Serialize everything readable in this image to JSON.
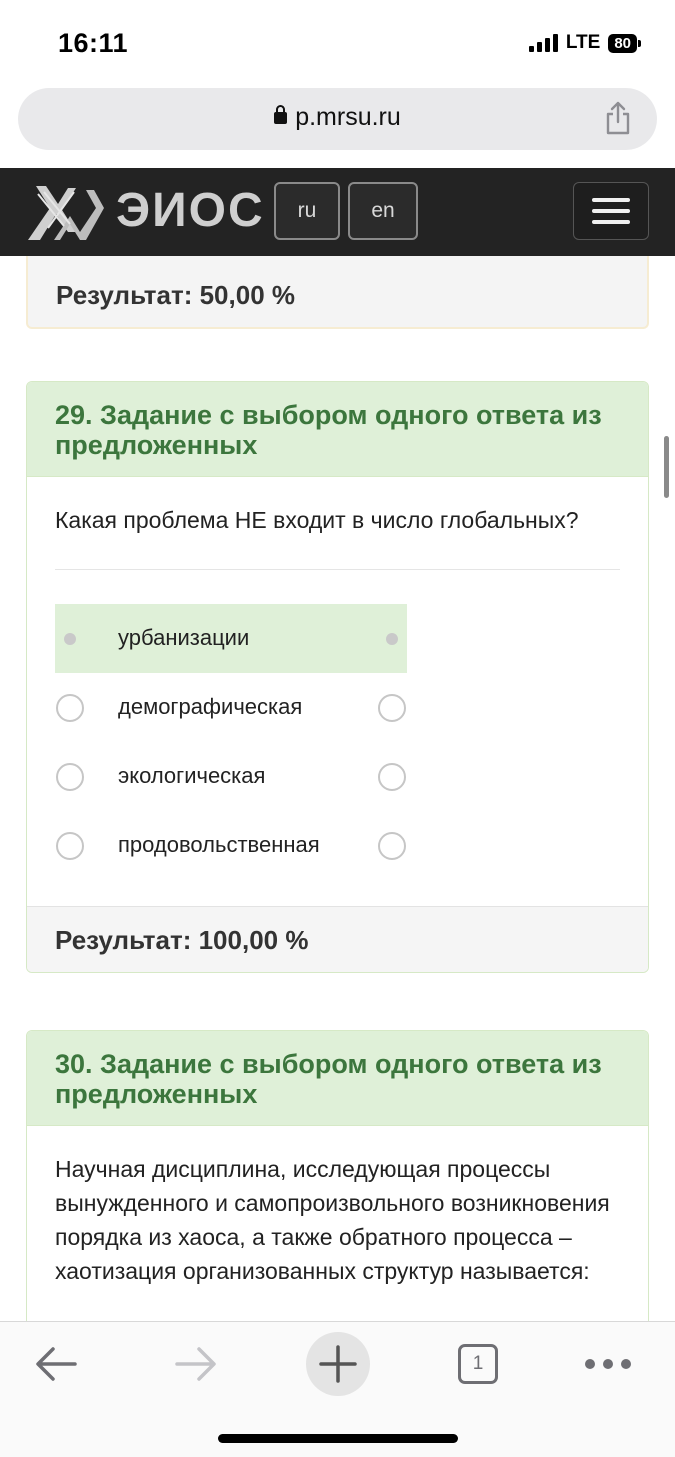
{
  "status": {
    "time": "16:11",
    "network": "LTE",
    "battery": "80"
  },
  "browser": {
    "url": "p.mrsu.ru",
    "tab_count": "1"
  },
  "site": {
    "logo_text": "ЭИОС",
    "lang_ru": "ru",
    "lang_en": "en"
  },
  "prev_result": {
    "label": "Результат:",
    "value": "50,00 %"
  },
  "questions": [
    {
      "title": "29. Задание с выбором одного ответа из предложенных",
      "text": "Какая проблема НЕ входит в число глобальных?",
      "answers": [
        {
          "label": "урбанизации",
          "selected": true
        },
        {
          "label": "демографическая",
          "selected": false
        },
        {
          "label": "экологическая",
          "selected": false
        },
        {
          "label": "продовольственная",
          "selected": false
        }
      ],
      "result_label": "Результат:",
      "result_value": "100,00 %"
    },
    {
      "title": "30. Задание с выбором одного ответа из предложенных",
      "text": "Научная дисциплина, исследующая процессы вынужденного и самопроизвольного возникновения порядка из хаоса, а также обратного процесса – хаотизация организованных структур называется:"
    }
  ],
  "colors": {
    "header_green_bg": "#dff0d8",
    "header_green_text": "#3c763d",
    "navbar": "#232323"
  },
  "icons": {
    "back": "arrow-left-icon",
    "forward": "arrow-right-icon",
    "new_tab": "plus-icon",
    "tabs": "tabs-icon",
    "more": "more-dots-icon",
    "share": "share-icon",
    "lock": "lock-icon",
    "menu": "hamburger-icon"
  }
}
